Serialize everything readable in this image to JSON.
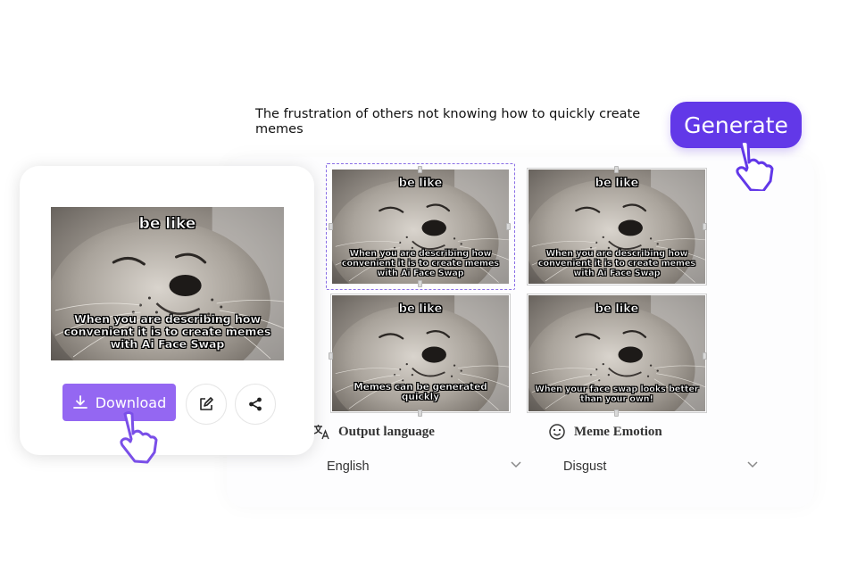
{
  "prompt": {
    "text": "The frustration of others not knowing how to quickly create memes"
  },
  "generate_button": {
    "label": "Generate"
  },
  "meme_variants": [
    {
      "top_text": "be like",
      "bottom_text": "When you are describing how convenient it is to create memes with Ai Face Swap",
      "selected": true
    },
    {
      "top_text": "be like",
      "bottom_text": "When you are describing how convenient it is to create memes with Ai Face Swap",
      "selected": false
    },
    {
      "top_text": "be like",
      "bottom_text": "Memes can be generated quickly",
      "selected": false
    },
    {
      "top_text": "be like",
      "bottom_text": "When your face swap looks better than your own!",
      "selected": false
    }
  ],
  "output_language": {
    "label": "Output language",
    "icon": "translate-icon",
    "value": "English"
  },
  "meme_emotion": {
    "label": "Meme Emotion",
    "icon": "smiley-icon",
    "value": "Disgust"
  },
  "result_card": {
    "meme": {
      "top_text": "be like",
      "bottom_text": "When you are describing how convenient it is to create memes with Ai Face Swap"
    },
    "download_label": "Download",
    "edit_icon": "edit-icon",
    "share_icon": "share-icon"
  },
  "colors": {
    "accent": "#6238e8",
    "download": "#9467f2",
    "selection": "#8a6ee6"
  }
}
